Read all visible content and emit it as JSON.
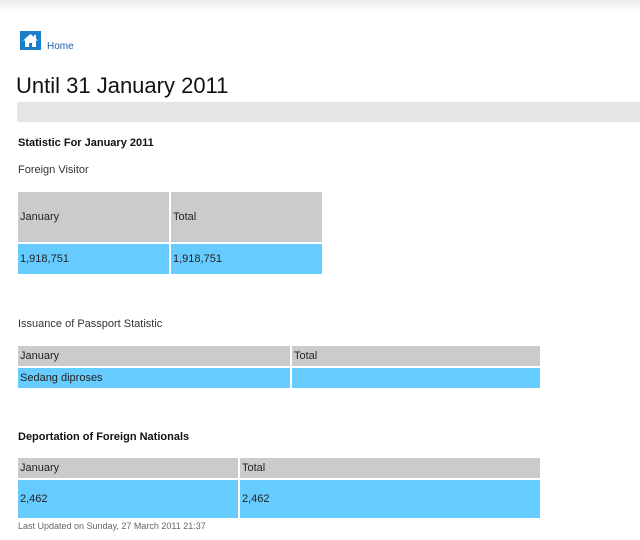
{
  "breadcrumb": {
    "home_label": "Home"
  },
  "page_title": "Until 31 January 2011",
  "statistic": {
    "title": "Statistic For January 2011",
    "foreign_visitor": {
      "title": "Foreign Visitor",
      "headers": [
        "January",
        "Total"
      ],
      "row": [
        "1,918,751",
        "1,918,751"
      ]
    }
  },
  "passport": {
    "title": "Issuance of Passport Statistic",
    "headers": [
      "January",
      "Total"
    ],
    "row": [
      "Sedang diproses",
      ""
    ]
  },
  "deportation": {
    "title": "Deportation of Foreign Nationals",
    "headers": [
      "January",
      "Total"
    ],
    "row": [
      "2,462",
      "2,462"
    ]
  },
  "footer": "Last Updated on Sunday, 27 March 2011 21:37",
  "colors": {
    "header_cell": "#cccbcb",
    "data_cell": "#66ccff",
    "link": "#1a5fa8"
  },
  "icons": {
    "home": "home-icon"
  }
}
